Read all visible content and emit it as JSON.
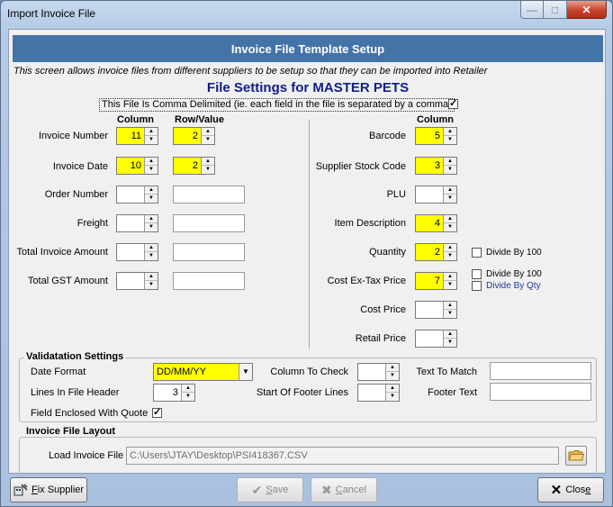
{
  "window": {
    "title": "Import Invoice File"
  },
  "header": {
    "banner": "Invoice File Template Setup",
    "description": "This screen allows invoice files from different suppliers to be setup so that they can be imported into Retailer",
    "file_title": "File Settings for MASTER PETS",
    "comma_label": "This File Is Comma Delimited (ie. each field in the file is separated by a comma)"
  },
  "left": {
    "col_head": "Column",
    "row_head": "Row/Value",
    "fields": [
      {
        "label": "Invoice Number",
        "column": "11",
        "row": "2"
      },
      {
        "label": "Invoice Date",
        "column": "10",
        "row": "2"
      },
      {
        "label": "Order Number",
        "column": "",
        "row": ""
      },
      {
        "label": "Freight",
        "column": "",
        "row": ""
      },
      {
        "label": "Total Invoice Amount",
        "column": "",
        "row": ""
      },
      {
        "label": "Total GST Amount",
        "column": "",
        "row": ""
      }
    ]
  },
  "right": {
    "col_head": "Column",
    "fields": [
      {
        "label": "Barcode",
        "column": "5"
      },
      {
        "label": "Supplier Stock Code",
        "column": "3"
      },
      {
        "label": "PLU",
        "column": ""
      },
      {
        "label": "Item Description",
        "column": "4"
      },
      {
        "label": "Quantity",
        "column": "2"
      },
      {
        "label": "Cost Ex-Tax Price",
        "column": "7"
      },
      {
        "label": "Cost Price",
        "column": ""
      },
      {
        "label": "Retail Price",
        "column": ""
      }
    ],
    "quantity_divide": "Divide By 100",
    "cost_divide_100": "Divide By 100",
    "cost_divide_qty": "Divide By Qty"
  },
  "validation": {
    "title": "Validatation Settings",
    "date_format_label": "Date Format",
    "date_format_value": "DD/MM/YY",
    "lines_header_label": "Lines In File Header",
    "lines_header_value": "3",
    "quote_label": "Field Enclosed With Quote",
    "column_check_label": "Column To Check",
    "footer_start_label": "Start Of Footer Lines",
    "text_match_label": "Text To Match",
    "footer_text_label": "Footer Text"
  },
  "layout": {
    "title": "Invoice File Layout",
    "load_label": "Load Invoice File",
    "path": "C:\\Users\\JTAY\\Desktop\\PSI418367.CSV"
  },
  "buttons": {
    "fix_prefix": "F",
    "fix_rest": "ix Supplier",
    "save_prefix": "S",
    "save_rest": "ave",
    "cancel_prefix": "C",
    "cancel_rest": "ancel",
    "close_prefix": "Clos",
    "close_u": "e"
  }
}
